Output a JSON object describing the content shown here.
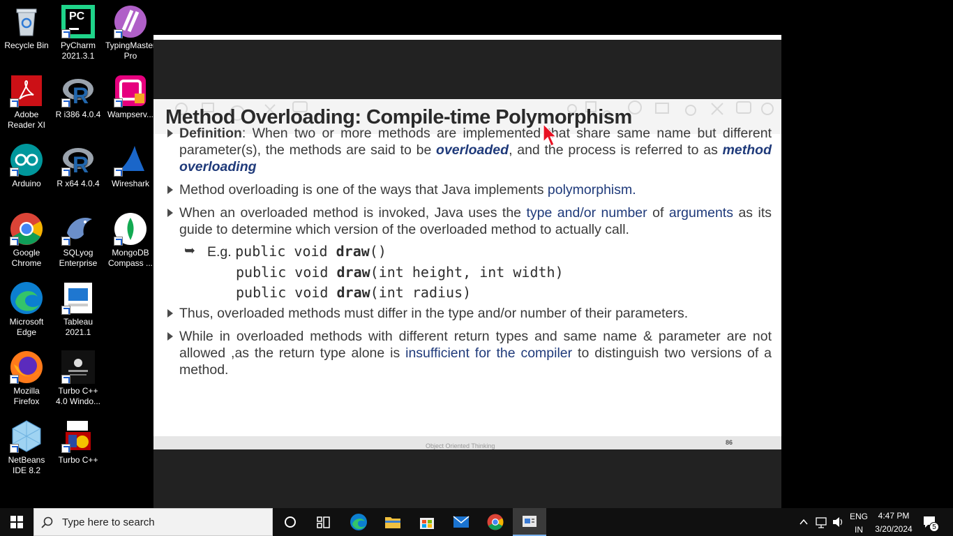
{
  "desktop": {
    "icons": [
      {
        "label": "Recycle Bin",
        "icon": "recycle-bin-icon"
      },
      {
        "label": "PyCharm 2021.3.1",
        "icon": "pycharm-icon"
      },
      {
        "label": "TypingMaster Pro",
        "icon": "typingmaster-icon"
      },
      {
        "label": "Adobe Reader XI",
        "icon": "adobe-reader-icon"
      },
      {
        "label": "R i386 4.0.4",
        "icon": "r-icon"
      },
      {
        "label": "Wampserv...",
        "icon": "wampserver-icon"
      },
      {
        "label": "Arduino",
        "icon": "arduino-icon"
      },
      {
        "label": "R x64 4.0.4",
        "icon": "r-icon"
      },
      {
        "label": "Wireshark",
        "icon": "wireshark-icon"
      },
      {
        "label": "Google Chrome",
        "icon": "chrome-icon"
      },
      {
        "label": "SQLyog Enterprise",
        "icon": "sqlyog-icon"
      },
      {
        "label": "MongoDB Compass ...",
        "icon": "mongodb-icon"
      },
      {
        "label": "Microsoft Edge",
        "icon": "edge-icon"
      },
      {
        "label": "Tableau 2021.1",
        "icon": "tableau-icon"
      },
      {
        "label": "Mozilla Firefox",
        "icon": "firefox-icon"
      },
      {
        "label": "Turbo C++ 4.0 Windo...",
        "icon": "turbo-cpp-windows-icon"
      },
      {
        "label": "NetBeans IDE 8.2",
        "icon": "netbeans-icon"
      },
      {
        "label": "Turbo C++",
        "icon": "turbo-cpp-icon"
      }
    ],
    "pycharm_badge": "PC"
  },
  "slide": {
    "title": "Method Overloading: Compile-time Polymorphism",
    "b1": {
      "label": "Definition",
      "t1": ": When two or more methods are implemented that share same name but different parameter(s), the methods are said to be ",
      "kw1": "overloaded",
      "t2": ", and the process is referred to as ",
      "kw2": "method overloading"
    },
    "b2": {
      "t1": "Method overloading is one of the ways that Java implements ",
      "hl1": "polymorphism",
      "t2": "."
    },
    "b3": {
      "t1": "When an overloaded method is invoked, Java uses the ",
      "hl1": "type and/or number",
      "t2": " of ",
      "hl2": "arguments",
      "t3": " as its guide to determine which version of the overloaded method to actually call."
    },
    "example": {
      "prefix": "E.g. ",
      "lines": [
        {
          "pre": "public void ",
          "name": "draw",
          "args": "()"
        },
        {
          "pre": "public void ",
          "name": "draw",
          "args": "(int height, int width)"
        },
        {
          "pre": "public void ",
          "name": "draw",
          "args": "(int radius)"
        }
      ]
    },
    "b4": {
      "t1": "Thus, overloaded methods must differ in the type and/or number of their parameters."
    },
    "b5": {
      "t1": "While in overloaded methods with different return types and same name & parameter are not allowed ,as  the return type alone is ",
      "hl1": "insufficient for the compiler",
      "t2": " to distinguish two versions of a method."
    },
    "footer": "Object Oriented Thinking",
    "page_number": "86"
  },
  "taskbar": {
    "search_placeholder": "Type here to search",
    "language": "ENG",
    "region": "IN",
    "time": "4:47 PM",
    "date": "3/20/2024",
    "notification_count": "5"
  }
}
